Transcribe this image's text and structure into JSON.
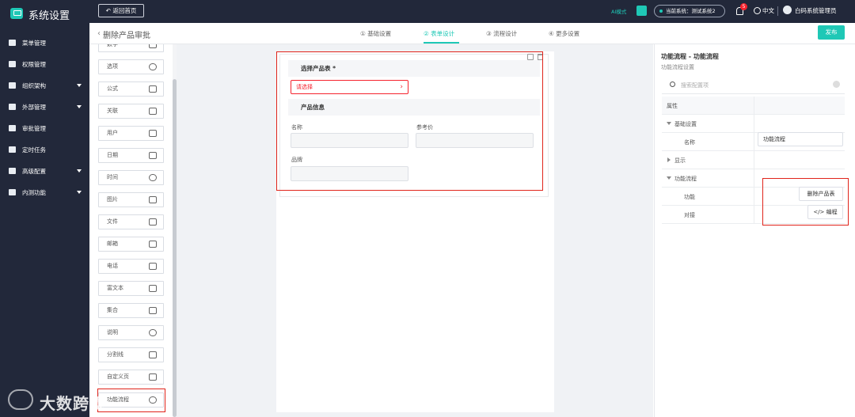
{
  "header": {
    "app_title": "系统设置",
    "back_home": "返回首页",
    "ai_mode": "AI模式",
    "current_system": "当前系统：测试系统2",
    "notification_count": "5",
    "language": "中文",
    "user_name": "白码系统管理员"
  },
  "sidebar": {
    "items": [
      {
        "label": "菜单管理",
        "icon": "grid-icon",
        "has_children": false
      },
      {
        "label": "权限管理",
        "icon": "user-key-icon",
        "has_children": false
      },
      {
        "label": "组织架构",
        "icon": "org-icon",
        "has_children": true
      },
      {
        "label": "外部管理",
        "icon": "users-icon",
        "has_children": true
      },
      {
        "label": "审批管理",
        "icon": "person-icon",
        "has_children": false
      },
      {
        "label": "定时任务",
        "icon": "clock-icon",
        "has_children": false
      },
      {
        "label": "高级配置",
        "icon": "sliders-icon",
        "has_children": true
      },
      {
        "label": "内测功能",
        "icon": "gear-icon",
        "has_children": true
      }
    ]
  },
  "subheader": {
    "page_title": "删除产品审批",
    "steps": [
      {
        "label": "① 基础设置"
      },
      {
        "label": "② 表单设计"
      },
      {
        "label": "③ 流程设计"
      },
      {
        "label": "④ 更多设置"
      }
    ],
    "active_step": "② 表单设计",
    "publish": "发布"
  },
  "palette": {
    "items": [
      {
        "label": "数字",
        "icon": "number-icon"
      },
      {
        "label": "选项",
        "icon": "option-icon"
      },
      {
        "label": "公式",
        "icon": "formula-icon"
      },
      {
        "label": "关联",
        "icon": "link-icon"
      },
      {
        "label": "用户",
        "icon": "user-icon"
      },
      {
        "label": "日期",
        "icon": "calendar-icon"
      },
      {
        "label": "时间",
        "icon": "clock-icon"
      },
      {
        "label": "图片",
        "icon": "image-icon"
      },
      {
        "label": "文件",
        "icon": "folder-icon"
      },
      {
        "label": "邮箱",
        "icon": "mail-icon"
      },
      {
        "label": "电话",
        "icon": "phone-icon"
      },
      {
        "label": "富文本",
        "icon": "richtext-icon"
      },
      {
        "label": "集合",
        "icon": "list-icon"
      },
      {
        "label": "说明",
        "icon": "info-icon"
      },
      {
        "label": "分割线",
        "icon": "divider-icon"
      },
      {
        "label": "自定义页",
        "icon": "code-icon"
      },
      {
        "label": "功能流程",
        "icon": "flow-icon"
      }
    ]
  },
  "form": {
    "section1_title": "选择产品表 *",
    "select_placeholder": "请选择",
    "section2_title": "产品信息",
    "field_name": "名称",
    "field_price": "参考价",
    "field_brand": "品牌"
  },
  "props": {
    "title": "功能流程 - 功能流程",
    "subtitle": "功能流程设置",
    "search_placeholder": "搜索配置项",
    "header_col": "属性",
    "group_basic": "基础设置",
    "row_name_label": "名称",
    "row_name_value": "功能流程",
    "group_display": "显示",
    "group_flow": "功能流程",
    "row_function_label": "功能",
    "row_function_value": "删除产品表",
    "row_connect_label": "对接",
    "row_connect_value": "</> 编程"
  },
  "watermark": "大数跨境",
  "colors": {
    "accent": "#1fc8b6",
    "sidebar_bg": "#22283a",
    "highlight": "#e0241b",
    "error": "#f5222d"
  }
}
